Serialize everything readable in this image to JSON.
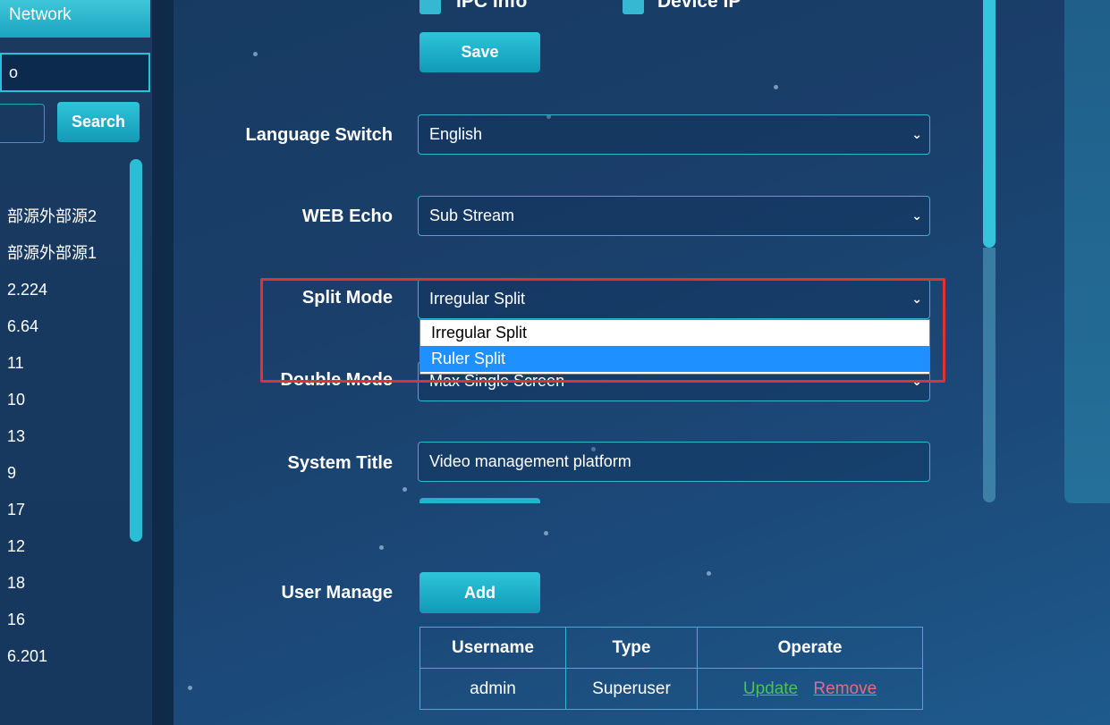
{
  "sidebar": {
    "tab_label": "Network",
    "search_value": "o",
    "search_button": "Search",
    "items": [
      "部源外部源2",
      "部源外部源1",
      "2.224",
      "6.64",
      "11",
      "10",
      "13",
      "9",
      "17",
      "12",
      "18",
      "16",
      "6.201"
    ]
  },
  "top": {
    "check1": "IPC info",
    "check2": "Device IP",
    "save_label": "Save"
  },
  "settings": {
    "language": {
      "label": "Language Switch",
      "value": "English"
    },
    "web_echo": {
      "label": "WEB Echo",
      "value": "Sub Stream"
    },
    "split_mode": {
      "label": "Split Mode",
      "value": "Irregular Split",
      "options": [
        "Irregular Split",
        "Ruler Split"
      ]
    },
    "double_mode": {
      "label": "Double Mode",
      "value": "Max Single Screen"
    },
    "system_title": {
      "label": "System Title",
      "value": "Video management platform"
    }
  },
  "users": {
    "label": "User Manage",
    "add_label": "Add",
    "columns": [
      "Username",
      "Type",
      "Operate"
    ],
    "rows": [
      {
        "username": "admin",
        "type": "Superuser",
        "update": "Update",
        "remove": "Remove"
      }
    ]
  },
  "colors": {
    "accent": "#2db7d2",
    "highlight": "#e0322e"
  },
  "icons": {
    "chevron": "chevron-down-icon",
    "checkbox": "checkbox-checked-icon"
  }
}
